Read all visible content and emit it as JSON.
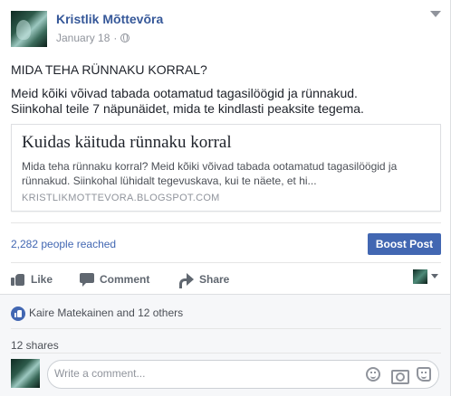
{
  "post": {
    "author": "Kristlik Mõttevõra",
    "date": "January 18",
    "date_separator": "·",
    "privacy_icon": "globe-icon",
    "text_lines": [
      "MIDA TEHA RÜNNAKU KORRAL?",
      "Meid kõiki võivad tabada ootamatud tagasilöögid ja rünnakud.",
      "Siinkohal teile 7 näpunäidet, mida te kindlasti peaksite tegema."
    ]
  },
  "link_card": {
    "title": "Kuidas käituda rünnaku korral",
    "description_lines": [
      "Mida teha rünnaku korral? Meid kõiki võivad tabada ootamatud tagasilöögid ja",
      "rünnakud. Siinkohal lühidalt tegevuskava, kui te näete, et hi..."
    ],
    "domain": "KRISTLIKMOTTEVORA.BLOGSPOT.COM"
  },
  "insights": {
    "reach": "2,282 people reached",
    "boost_label": "Boost Post"
  },
  "actions": {
    "like": "Like",
    "comment": "Comment",
    "share": "Share"
  },
  "reactions": {
    "likers": "Kaire Matekainen and 12 others",
    "shares": "12 shares"
  },
  "comment_box": {
    "placeholder": "Write a comment..."
  },
  "colors": {
    "accent": "#4267b2",
    "author_link": "#365899",
    "muted": "#90949c",
    "panel": "#f6f7f9"
  }
}
